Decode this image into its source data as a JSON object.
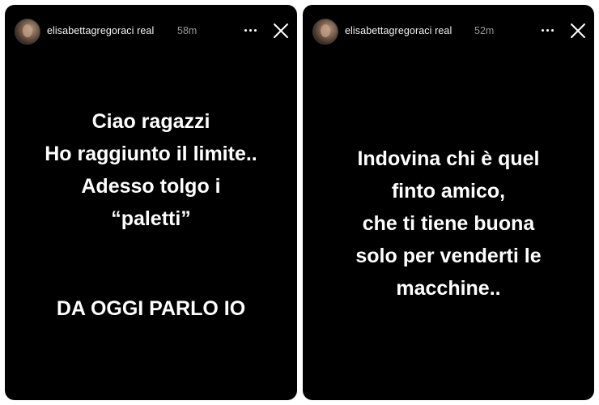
{
  "stories": [
    {
      "username": "elisabettagregoraci real",
      "time": "58m",
      "lines": [
        "Ciao ragazzi",
        "Ho raggiunto il limite..",
        "Adesso tolgo i",
        "“paletti”"
      ],
      "footer": "DA OGGI PARLO IO"
    },
    {
      "username": "elisabettagregoraci real",
      "time": "52m",
      "lines": [
        "Indovina chi è quel",
        "finto amico,",
        "che ti tiene buona",
        "solo per venderti le",
        "macchine.."
      ]
    }
  ],
  "icons": {
    "more": "more-horizontal-icon",
    "close": "close-icon",
    "avatar": "profile-avatar"
  }
}
